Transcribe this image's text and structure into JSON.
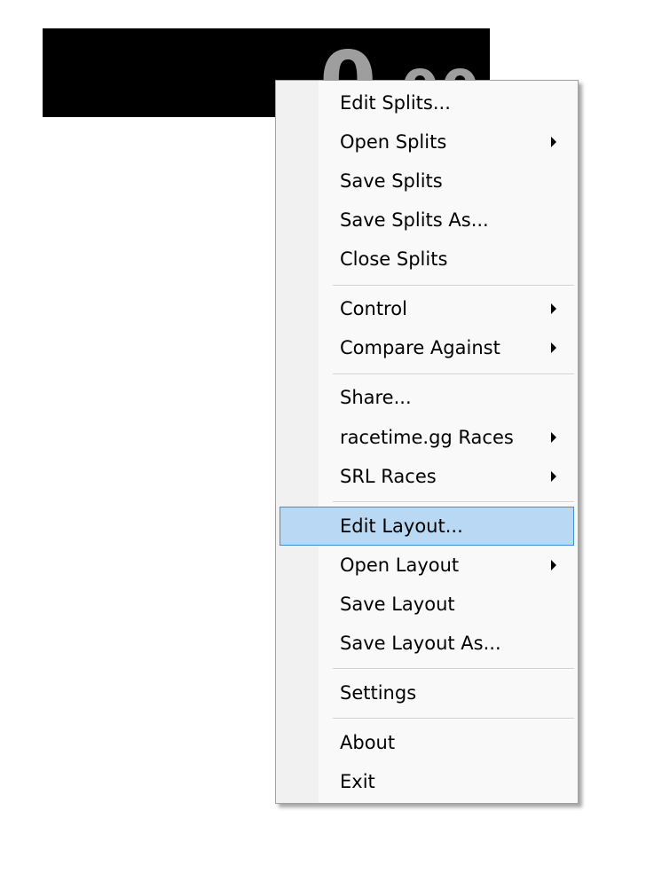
{
  "timer": {
    "main": "0",
    "fraction": ".00"
  },
  "menu": {
    "items": [
      {
        "label": "Edit Splits...",
        "submenu": false
      },
      {
        "label": "Open Splits",
        "submenu": true
      },
      {
        "label": "Save Splits",
        "submenu": false
      },
      {
        "label": "Save Splits As...",
        "submenu": false
      },
      {
        "label": "Close Splits",
        "submenu": false
      },
      {
        "label": "Control",
        "submenu": true
      },
      {
        "label": "Compare Against",
        "submenu": true
      },
      {
        "label": "Share...",
        "submenu": false
      },
      {
        "label": "racetime.gg Races",
        "submenu": true
      },
      {
        "label": "SRL Races",
        "submenu": true
      },
      {
        "label": "Edit Layout...",
        "submenu": false,
        "highlighted": true
      },
      {
        "label": "Open Layout",
        "submenu": true
      },
      {
        "label": "Save Layout",
        "submenu": false
      },
      {
        "label": "Save Layout As...",
        "submenu": false
      },
      {
        "label": "Settings",
        "submenu": false
      },
      {
        "label": "About",
        "submenu": false
      },
      {
        "label": "Exit",
        "submenu": false
      }
    ]
  },
  "colors": {
    "highlight_bg": "#b8d8f3",
    "highlight_border": "#3d8fd9",
    "timer_bg": "#000000",
    "timer_text": "#9e9e9e"
  }
}
